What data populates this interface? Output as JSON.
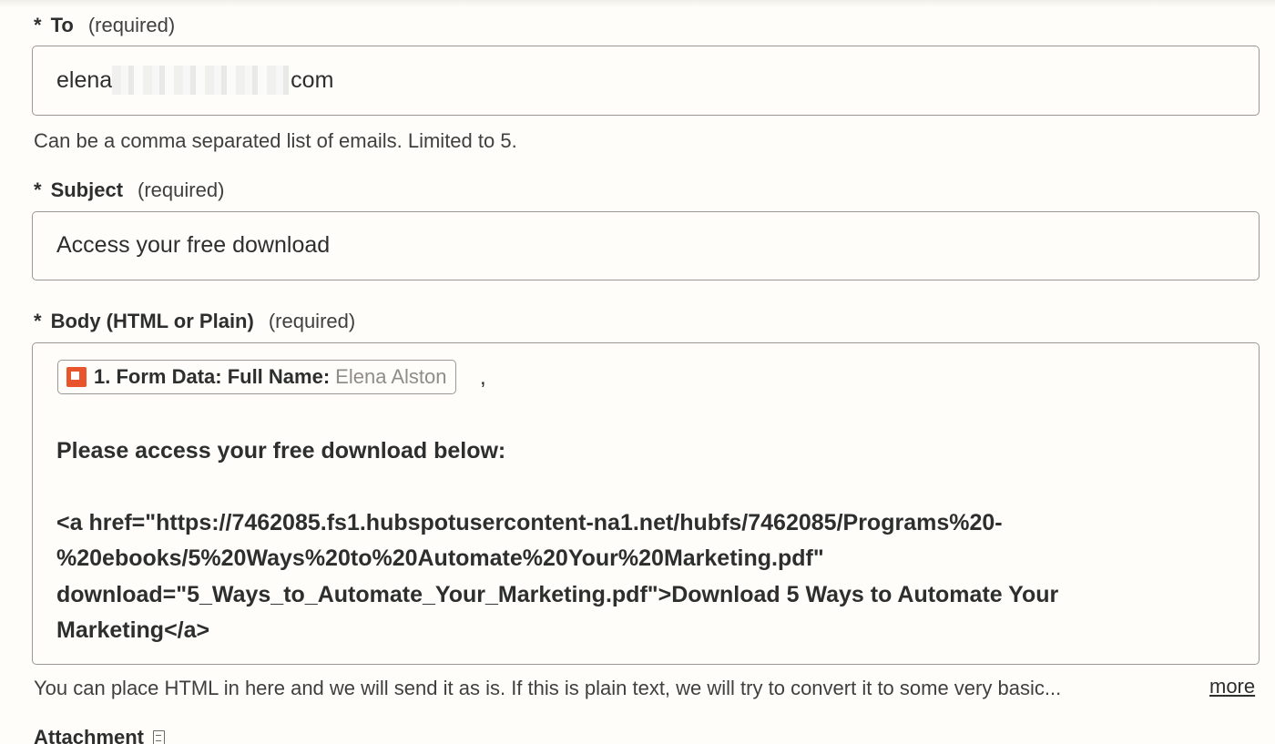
{
  "fields": {
    "to": {
      "star": "*",
      "label": "To",
      "required": "(required)",
      "value_prefix": "elena",
      "value_suffix": "com",
      "help": "Can be a comma separated list of emails. Limited to 5."
    },
    "subject": {
      "star": "*",
      "label": "Subject",
      "required": "(required)",
      "value": "Access your free download"
    },
    "body": {
      "star": "*",
      "label": "Body (HTML or Plain)",
      "required": "(required)",
      "pill": {
        "icon": "form-data-icon",
        "key": "1. Form Data: Full Name:",
        "value": "Elena Alston"
      },
      "after_pill": ",",
      "lines": [
        "Please access your free download below:",
        "<a href=\"https://7462085.fs1.hubspotusercontent-na1.net/hubfs/7462085/Programs%20-",
        "%20ebooks/5%20Ways%20to%20Automate%20Your%20Marketing.pdf\"",
        "download=\"5_Ways_to_Automate_Your_Marketing.pdf\">Download 5 Ways to Automate Your",
        "Marketing</a>"
      ],
      "help": "You can place HTML in here and we will send it as is. If this is plain text, we will try to convert it to some very basic...",
      "more": "more"
    },
    "attachment": {
      "label": "Attachment",
      "icon": "document-icon"
    }
  },
  "colors": {
    "background": "#fffdf9",
    "border": "#9b9893",
    "text": "#2d2e2e",
    "accent": "#e8542b"
  }
}
